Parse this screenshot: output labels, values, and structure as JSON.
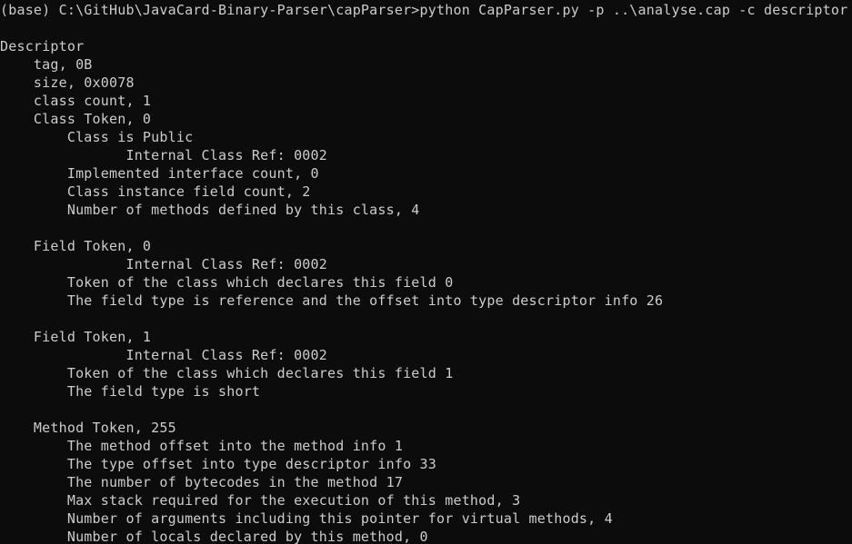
{
  "terminal": {
    "lines": [
      "(base) C:\\GitHub\\JavaCard-Binary-Parser\\capParser>python CapParser.py -p ..\\analyse.cap -c descriptor",
      "",
      "Descriptor",
      "    tag, 0B",
      "    size, 0x0078",
      "    class count, 1",
      "    Class Token, 0",
      "        Class is Public",
      "               Internal Class Ref: 0002",
      "        Implemented interface count, 0",
      "        Class instance field count, 2",
      "        Number of methods defined by this class, 4",
      "",
      "    Field Token, 0",
      "               Internal Class Ref: 0002",
      "        Token of the class which declares this field 0",
      "        The field type is reference and the offset into type descriptor info 26",
      "",
      "    Field Token, 1",
      "               Internal Class Ref: 0002",
      "        Token of the class which declares this field 1",
      "        The field type is short",
      "",
      "    Method Token, 255",
      "        The method offset into the method info 1",
      "        The type offset into type descriptor info 33",
      "        The number of bytecodes in the method 17",
      "        Max stack required for the execution of this method, 3",
      "        Number of arguments including this pointer for virtual methods, 4",
      "        Number of locals declared by this method, 0"
    ]
  },
  "colors": {
    "background": "#0c0c0c",
    "foreground": "#cccccc"
  }
}
